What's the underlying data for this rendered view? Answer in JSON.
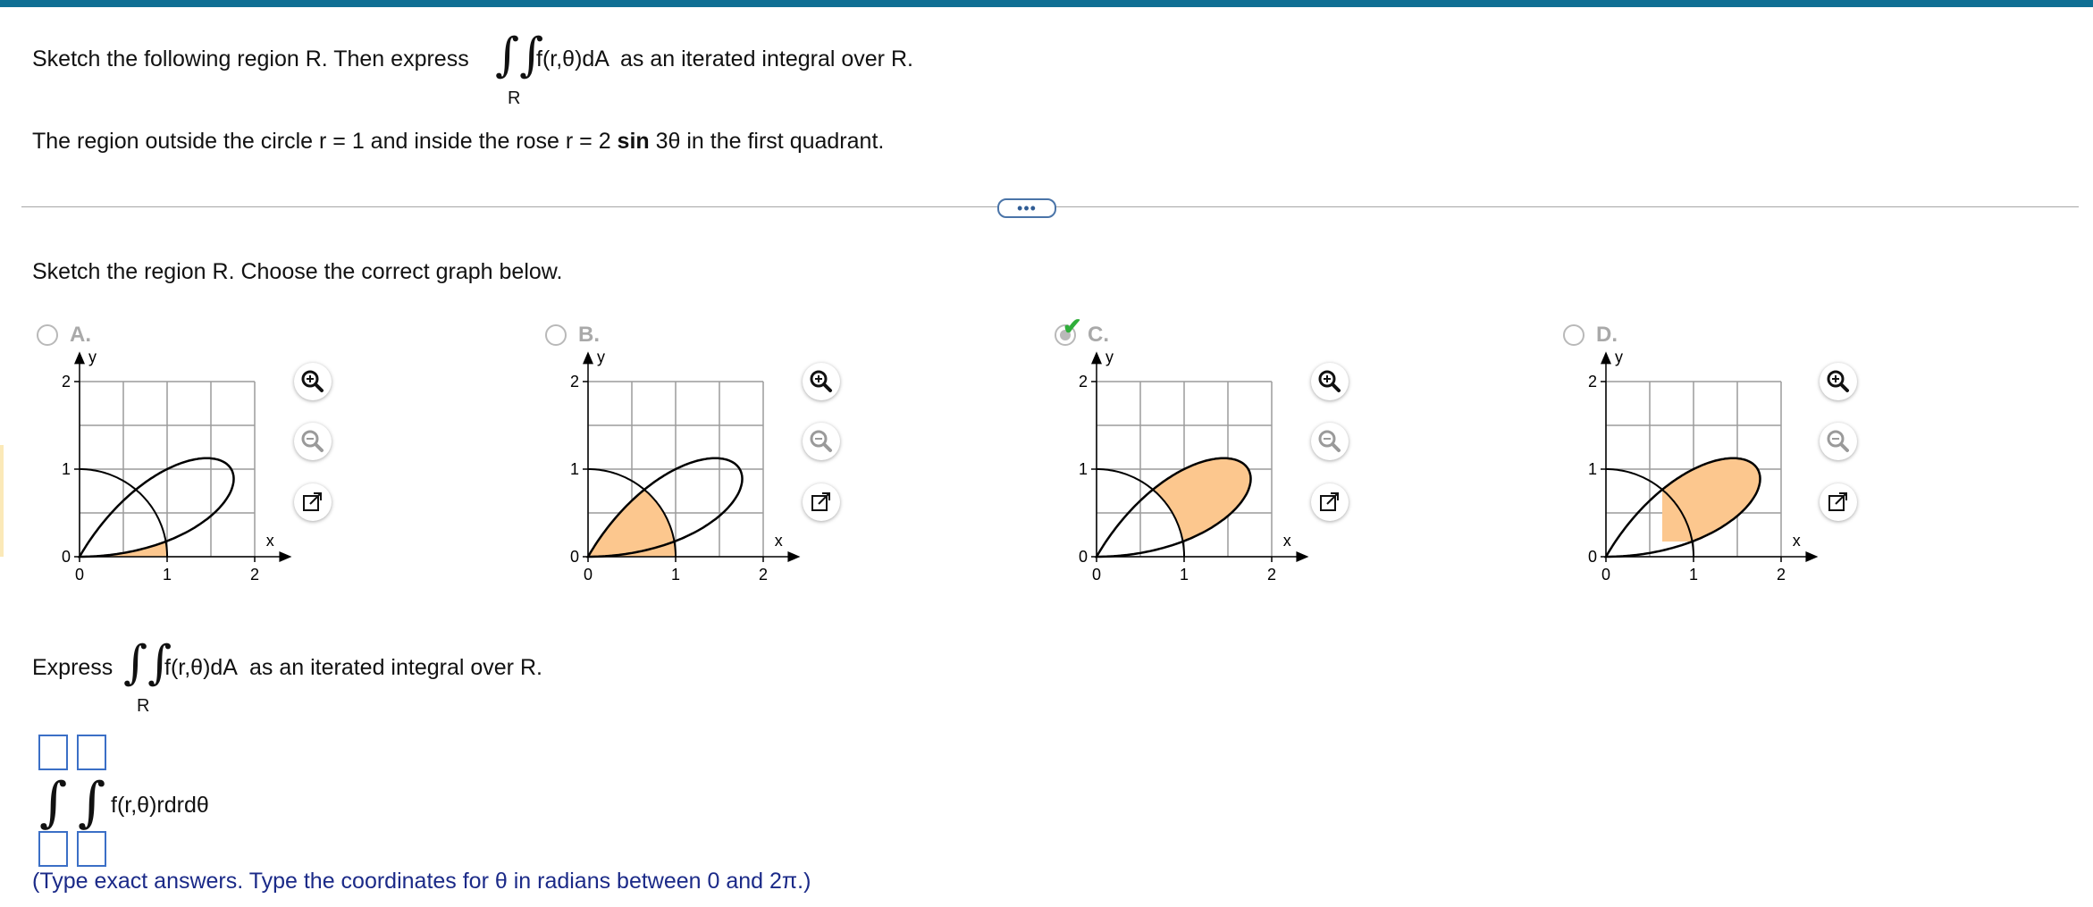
{
  "question": {
    "prompt_before": "Sketch the following region R. Then express",
    "integrand": "f(r,θ)dA",
    "prompt_after": "as an iterated integral over R.",
    "region_sub": "R",
    "region_text_1": "The region outside the circle r = 1 and inside the rose r = 2 ",
    "region_sin": "sin",
    "region_text_2": " 3θ in the first quadrant."
  },
  "divider": {
    "more_label": "•••"
  },
  "part1": {
    "instruction": "Sketch the region R. Choose the correct graph below.",
    "options": [
      {
        "label": "A.",
        "selected": false,
        "shading": "inside-circle-below-lower-petal-edge"
      },
      {
        "label": "B.",
        "selected": false,
        "shading": "inside-circle-above-lower-petal-edge"
      },
      {
        "label": "C.",
        "selected": true,
        "shading": "inside-petal-outside-circle"
      },
      {
        "label": "D.",
        "selected": false,
        "shading": "inside-petal-right-of-circle"
      }
    ],
    "correct_icon": "check-icon",
    "graph": {
      "x_label": "x",
      "y_label": "y",
      "x_ticks": [
        "0",
        "1",
        "2"
      ],
      "y_ticks": [
        "0",
        "1",
        "2"
      ],
      "xlim": [
        0,
        2
      ],
      "ylim": [
        0,
        2
      ],
      "fill_color": "#fcc78e",
      "grid": true
    },
    "tools": [
      "zoom-in-icon",
      "zoom-out-icon",
      "open-new-window-icon"
    ]
  },
  "part2": {
    "express_prefix": "Express",
    "integrand": "f(r,θ)dA",
    "express_suffix": "as an iterated integral over R.",
    "region_sub": "R",
    "answer_integrand": "f(r,θ)rdrdθ",
    "note": "(Type exact answers. Type the coordinates for θ in radians between 0 and 2π.)"
  },
  "colors": {
    "topbar": "#0f6f94",
    "accent_blue": "#1b2a88",
    "fill": "#fcc78e",
    "check": "#2fae3a"
  }
}
